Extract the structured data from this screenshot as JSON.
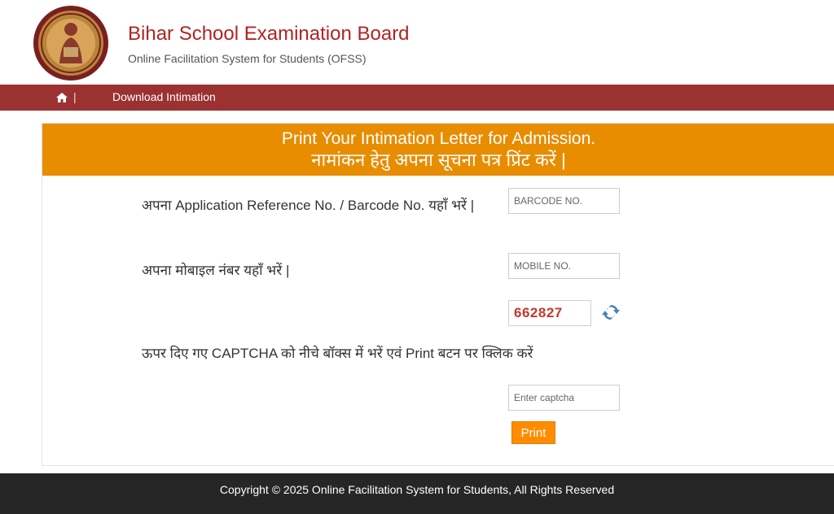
{
  "header": {
    "title": "Bihar School Examination Board",
    "subtitle": "Online Facilitation System for Students (OFSS)"
  },
  "nav": {
    "home_icon": "home-icon",
    "separator": "|",
    "link": "Download Intimation"
  },
  "panel": {
    "heading_en": "Print Your Intimation Letter for Admission.",
    "heading_hi": "नामांकन हेतु अपना सूचना पत्र प्रिंट करें |"
  },
  "form": {
    "ref_label": "अपना Application Reference No. / Barcode No. यहाँ भरें |",
    "ref_placeholder": "BARCODE NO.",
    "ref_value": "",
    "mobile_label": "अपना मोबाइल नंबर यहाँ भरें |",
    "mobile_placeholder": "MOBILE NO.",
    "mobile_value": "",
    "captcha_code": "662827",
    "refresh_icon": "refresh-icon",
    "captcha_label": "ऊपर दिए गए CAPTCHA को नीचे बॉक्स में भरें एवं Print बटन पर क्लिक करें",
    "captcha_placeholder": "Enter captcha",
    "captcha_value": "",
    "print_label": "Print"
  },
  "footer": {
    "text": "Copyright © 2025 Online Facilitation System for Students, All Rights Reserved"
  },
  "colors": {
    "brand_red": "#b22222",
    "nav_bg": "#9b3131",
    "panel_head": "#e88c00",
    "print_button": "#ff8c00",
    "captcha_text": "#c0392b",
    "footer_bg": "#262626"
  }
}
